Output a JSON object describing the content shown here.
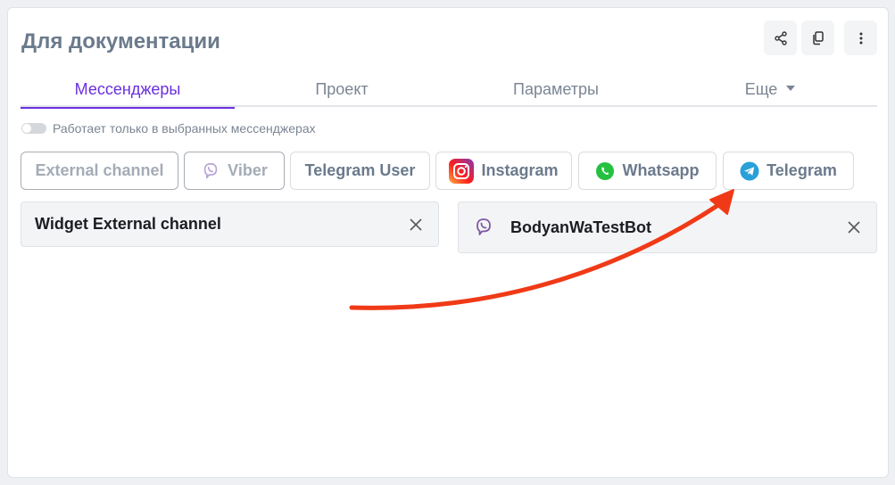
{
  "header": {
    "title": "Для документации"
  },
  "toolbar": {
    "share_icon": "share-icon",
    "copy_icon": "copy-icon",
    "more_icon": "more-vertical-icon"
  },
  "tabs": [
    {
      "label": "Мессенджеры",
      "active": true
    },
    {
      "label": "Проект",
      "active": false
    },
    {
      "label": "Параметры",
      "active": false
    },
    {
      "label": "Еще",
      "active": false,
      "dropdown": true
    }
  ],
  "filter": {
    "toggle_label": "Работает только в выбранных мессенджерах",
    "toggle_on": false
  },
  "channels": [
    {
      "label": "External channel",
      "selected": true,
      "icon": ""
    },
    {
      "label": "Viber",
      "selected": true,
      "icon": "viber-icon"
    },
    {
      "label": "Telegram User",
      "selected": false,
      "icon": ""
    },
    {
      "label": "Instagram",
      "selected": false,
      "icon": "instagram-icon"
    },
    {
      "label": "Whatsapp",
      "selected": false,
      "icon": "whatsapp-icon"
    },
    {
      "label": "Telegram",
      "selected": false,
      "icon": "telegram-icon"
    }
  ],
  "panels": [
    {
      "title": "Widget External channel",
      "icon": ""
    },
    {
      "title": "BodyanWaTestBot",
      "icon": "viber-icon"
    }
  ],
  "colors": {
    "accent": "#6a2fe0",
    "viber": "#7d59a3",
    "whatsapp": "#25c040",
    "telegram": "#29a0d8",
    "annotation_arrow": "#f03a17"
  },
  "annotation": {
    "type": "arrow",
    "points_to": "Telegram"
  }
}
